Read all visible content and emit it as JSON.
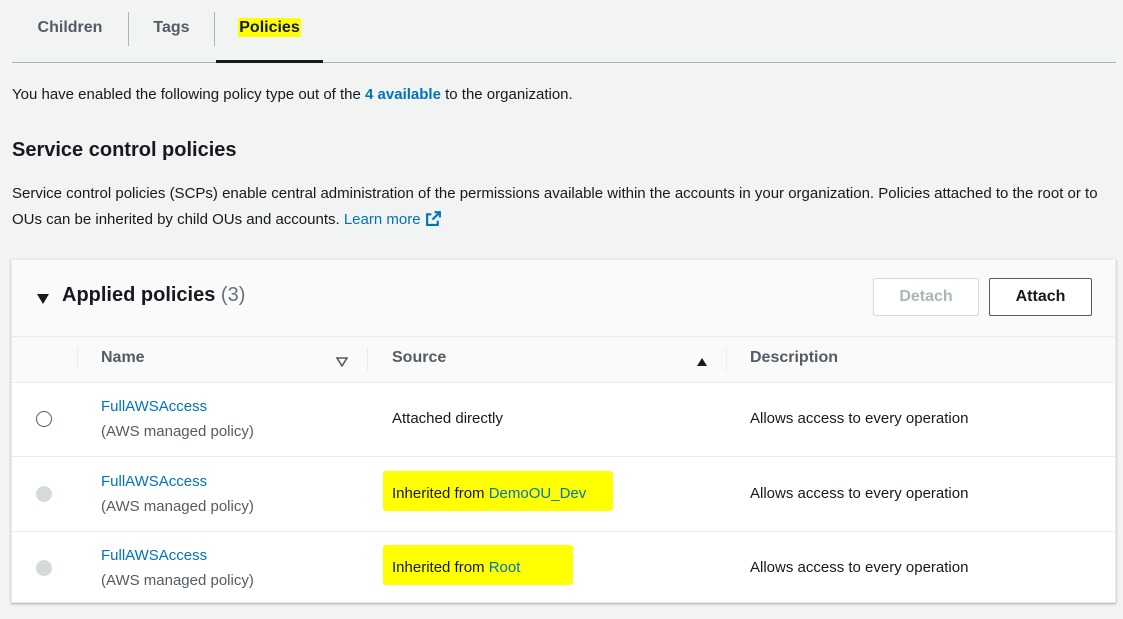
{
  "tabs": [
    {
      "label": "Children",
      "active": false
    },
    {
      "label": "Tags",
      "active": false
    },
    {
      "label": "Policies",
      "active": true
    }
  ],
  "intro": {
    "prefix": "You have enabled the following policy type out of the ",
    "link": "4 available",
    "suffix": " to the organization."
  },
  "section": {
    "title": "Service control policies",
    "description": "Service control policies (SCPs) enable central administration of the permissions available within the accounts in your organization. Policies attached to the root or to OUs can be inherited by child OUs and accounts.",
    "learn_more": "Learn more"
  },
  "panel": {
    "title": "Applied policies",
    "count": "(3)",
    "detach_label": "Detach",
    "attach_label": "Attach"
  },
  "table": {
    "columns": [
      "Name",
      "Source",
      "Description"
    ],
    "rows": [
      {
        "name": "FullAWSAccess",
        "type": "(AWS managed policy)",
        "source_prefix": "Attached directly",
        "source_link": "",
        "description": "Allows access to every operation",
        "selectable": true
      },
      {
        "name": "FullAWSAccess",
        "type": "(AWS managed policy)",
        "source_prefix": "Inherited from ",
        "source_link": "DemoOU_Dev",
        "description": "Allows access to every operation",
        "selectable": false
      },
      {
        "name": "FullAWSAccess",
        "type": "(AWS managed policy)",
        "source_prefix": "Inherited from ",
        "source_link": "Root",
        "description": "Allows access to every operation",
        "selectable": false
      }
    ]
  },
  "colors": {
    "link": "#0073bb",
    "highlight": "#ffff00",
    "background": "#f2f3f3"
  }
}
